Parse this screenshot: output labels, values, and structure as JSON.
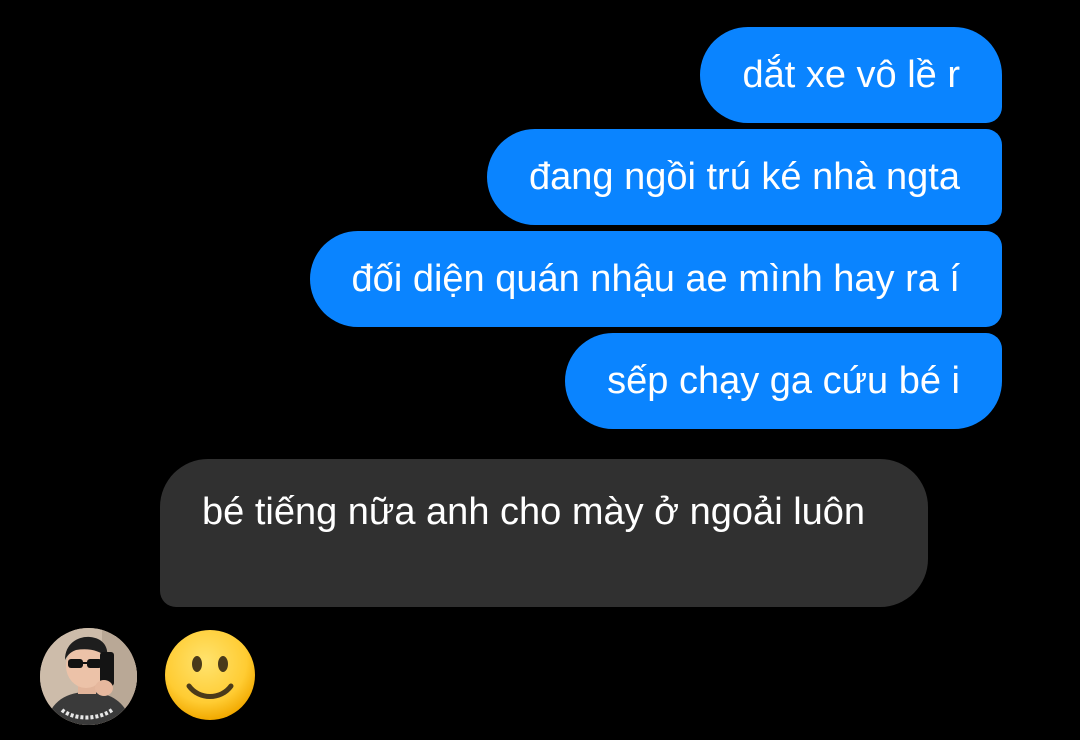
{
  "conversation": {
    "sent": [
      {
        "text": "dắt xe vô lề r"
      },
      {
        "text": "đang ngồi trú ké nhà ngta"
      },
      {
        "text": "đối diện quán nhậu ae mình hay ra í"
      },
      {
        "text": "sếp chạy ga cứu bé i"
      }
    ],
    "received": [
      {
        "text": "bé tiếng nữa anh cho mày ở ngoải luôn"
      }
    ],
    "reaction": {
      "icon": "slightly-smiling-face-emoji"
    }
  },
  "colors": {
    "background": "#000000",
    "sent_bubble": "#0a84ff",
    "received_bubble": "#303030",
    "text": "#ffffff",
    "emoji_face": "#ffcc33"
  },
  "contact": {
    "avatar": "contact-avatar"
  }
}
